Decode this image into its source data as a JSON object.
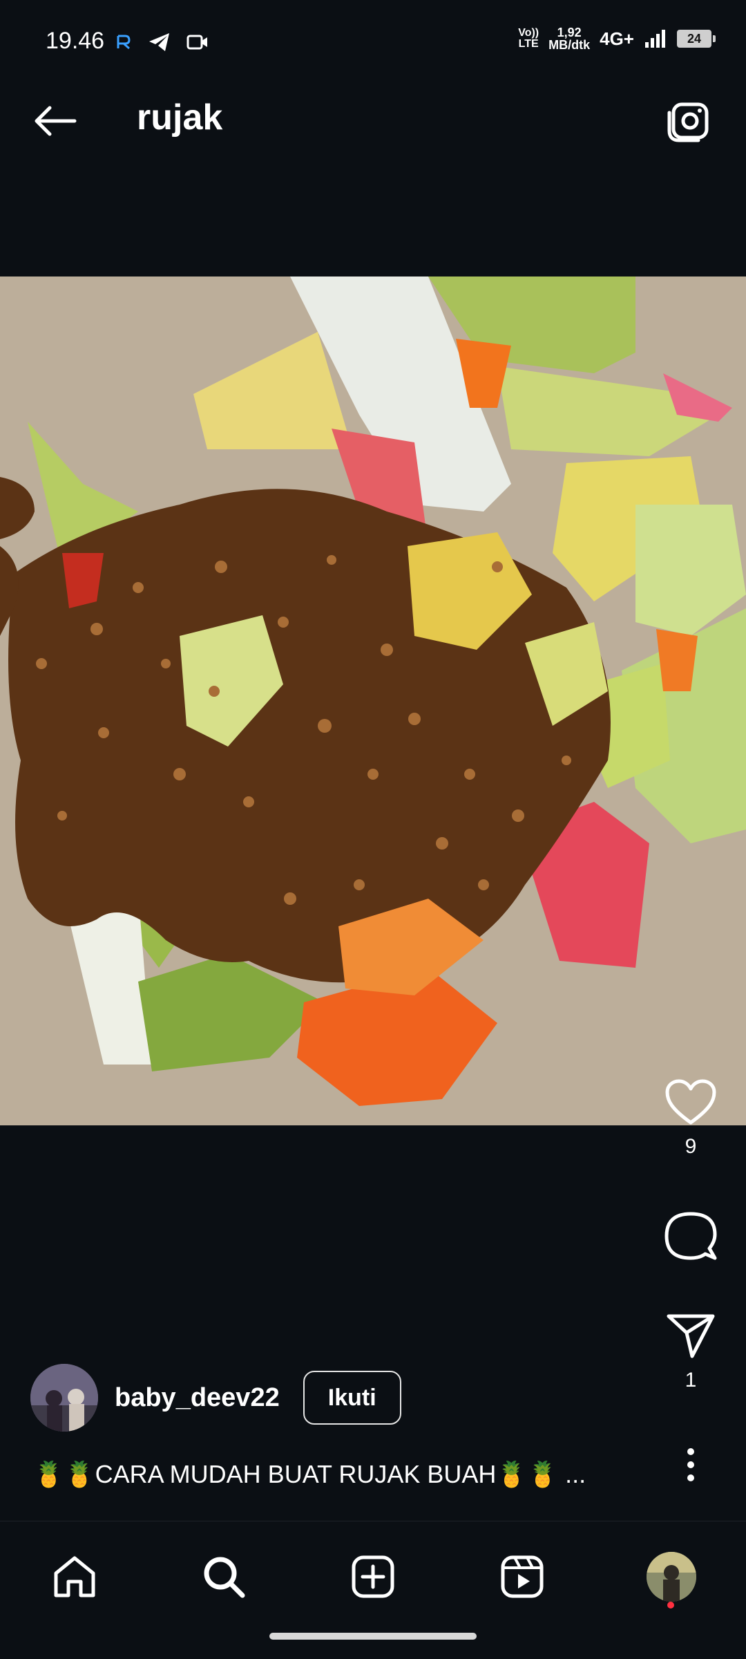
{
  "status_bar": {
    "time": "19.46",
    "volte_top": "Vo))",
    "volte_bottom": "LTE",
    "speed_value": "1,92",
    "speed_unit": "MB/dtk",
    "network": "4G+",
    "battery": "24"
  },
  "header": {
    "title": "rujak",
    "back_icon": "back-arrow-icon",
    "camera_icon": "camera-icon"
  },
  "post": {
    "image_subject": "rujak",
    "likes": "9",
    "shares": "1"
  },
  "author": {
    "username": "baby_deev22",
    "follow_label": "Ikuti"
  },
  "caption": {
    "text": "🍍🍍CARA MUDAH BUAT RUJAK BUAH🍍🍍 ..."
  },
  "bottom_nav": {
    "items": [
      "home-icon",
      "search-icon",
      "create-icon",
      "reels-icon",
      "profile-avatar"
    ]
  },
  "colors": {
    "background": "#0b0f14",
    "text": "#ffffff",
    "notification": "#ff3040"
  }
}
